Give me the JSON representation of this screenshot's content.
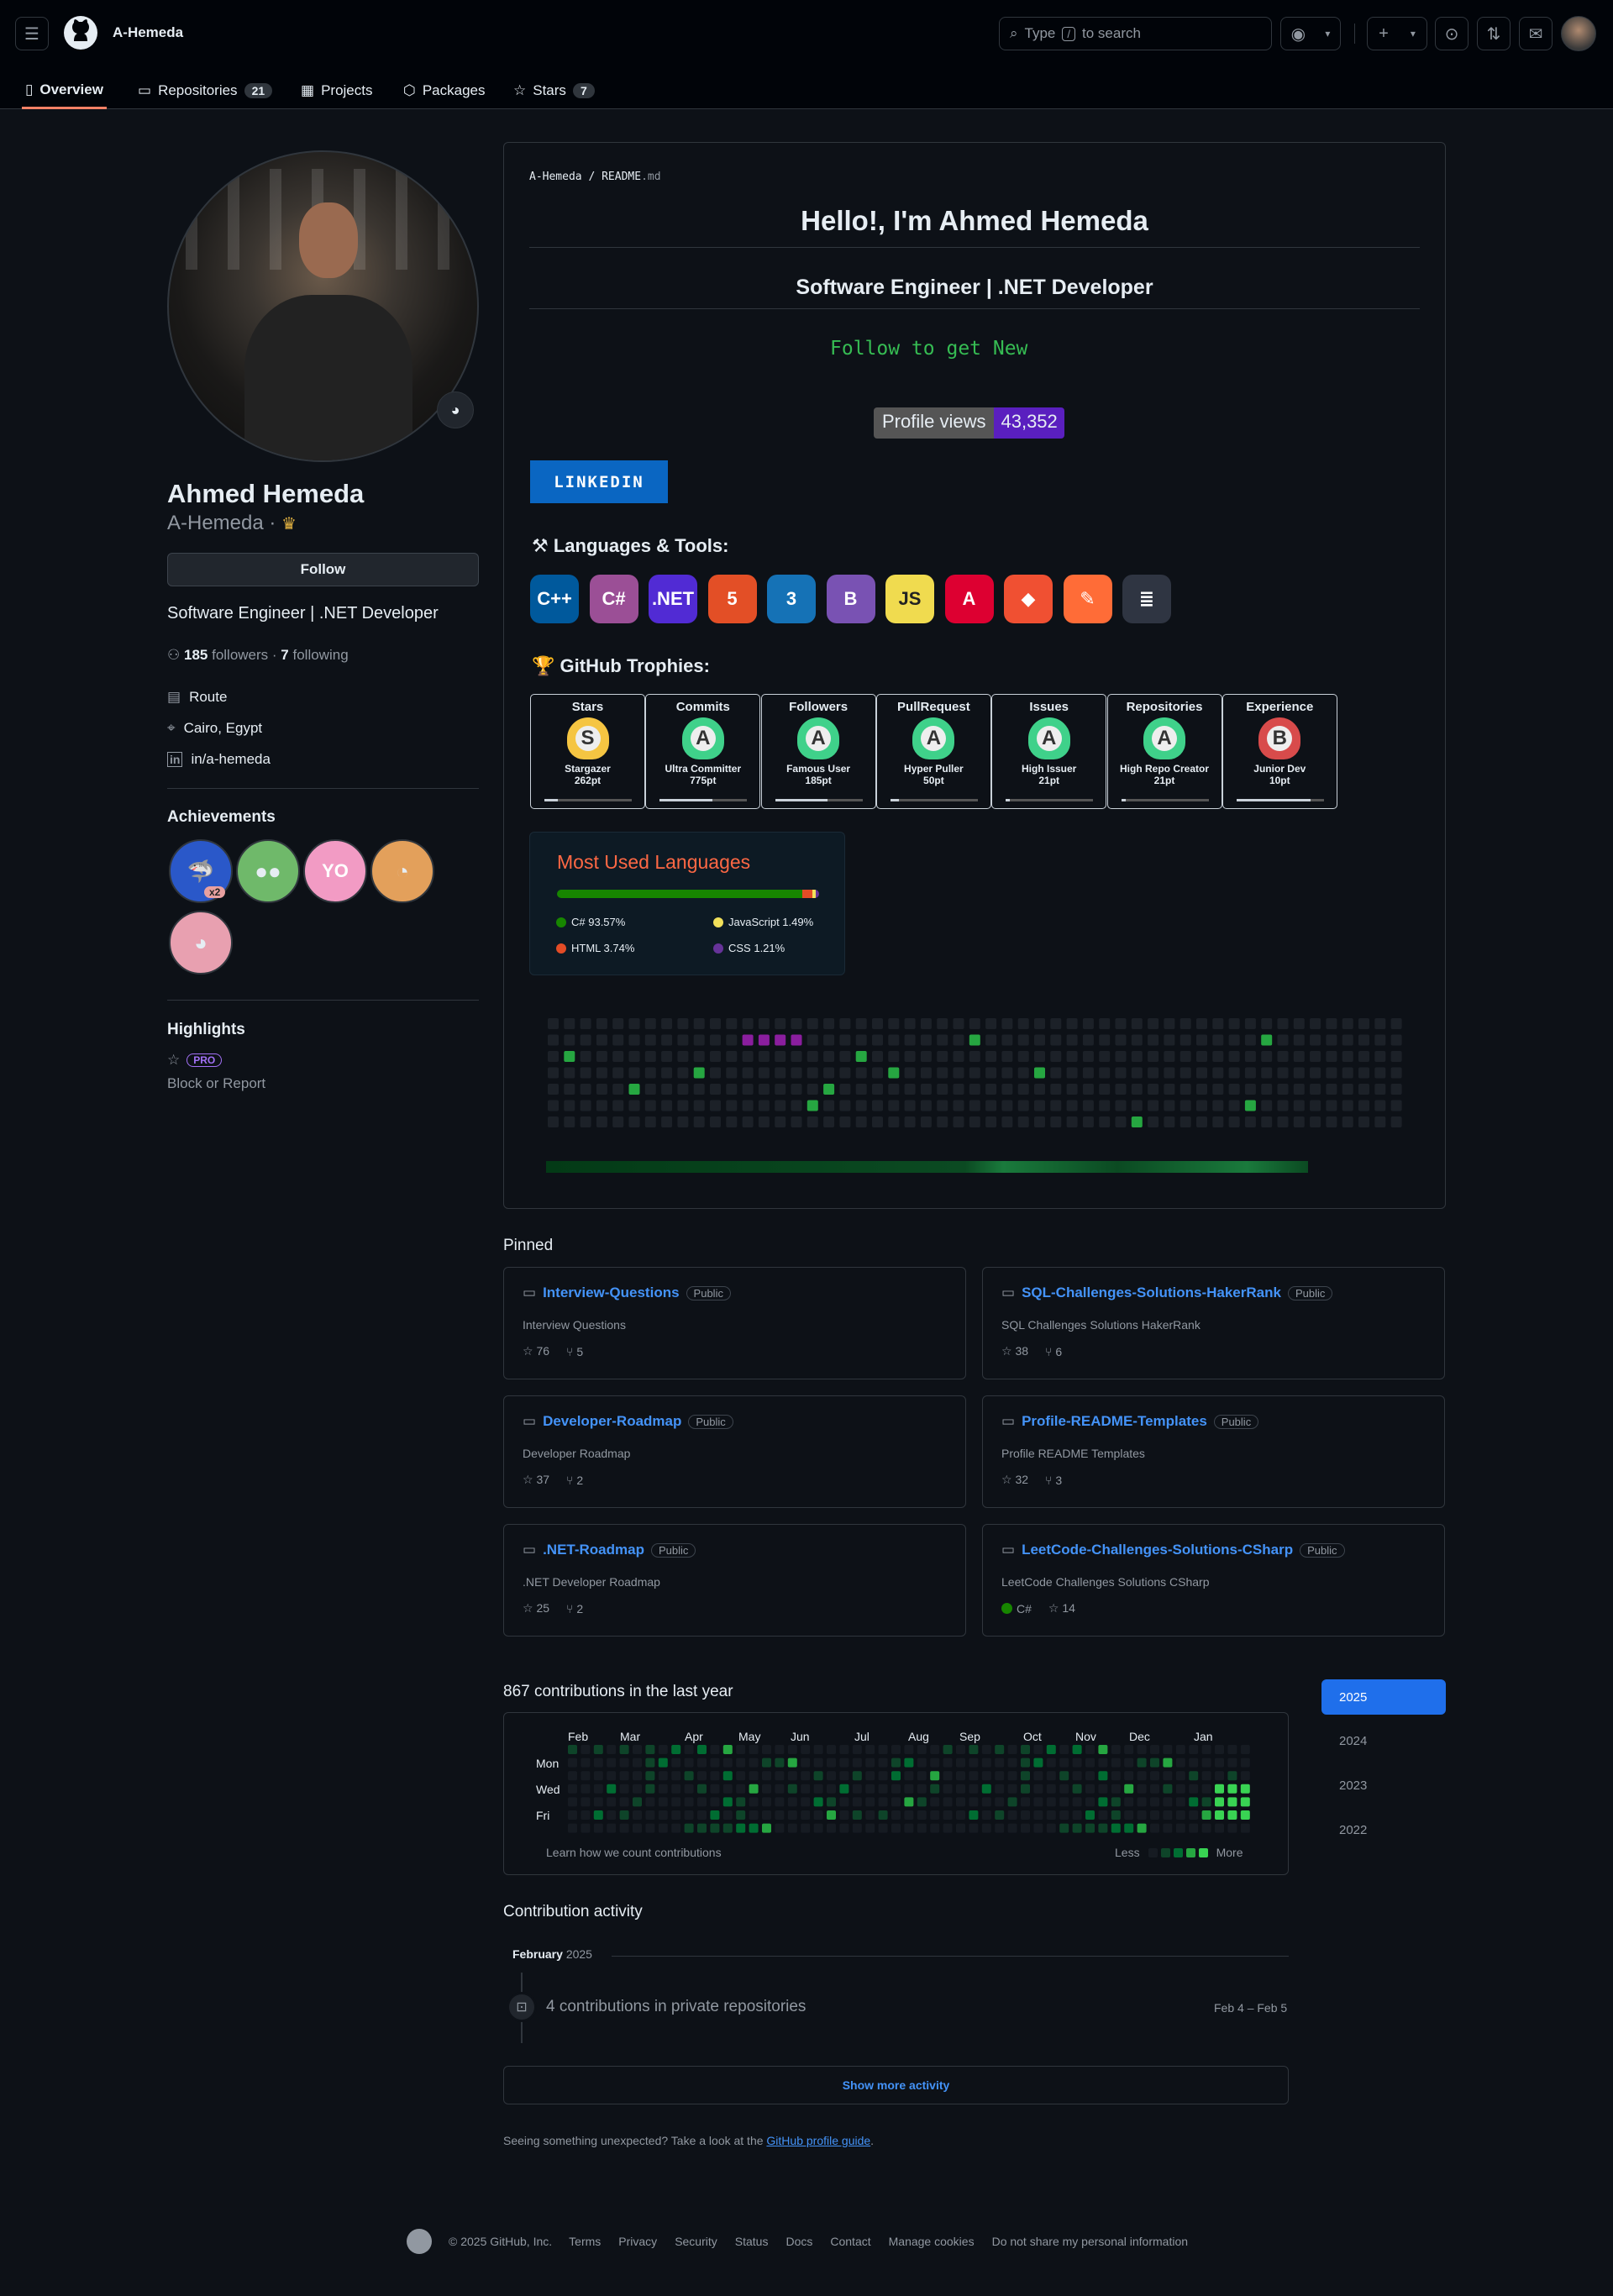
{
  "header": {
    "username": "A-Hemeda",
    "search_placeholder_pre": "Type",
    "search_key": "/",
    "search_placeholder_post": "to search",
    "tabs": [
      {
        "label": "Overview",
        "count": ""
      },
      {
        "label": "Repositories",
        "count": "21"
      },
      {
        "label": "Projects",
        "count": ""
      },
      {
        "label": "Packages",
        "count": ""
      },
      {
        "label": "Stars",
        "count": "7"
      }
    ]
  },
  "sidebar": {
    "name": "Ahmed Hemeda",
    "login": "A-Hemeda",
    "follow_label": "Follow",
    "bio": "Software Engineer | .NET Developer",
    "followers_count": "185",
    "followers_label": "followers",
    "following_count": "7",
    "following_label": "following",
    "company": "Route",
    "location": "Cairo, Egypt",
    "linkedin": "in/a-hemeda",
    "achievements_title": "Achievements",
    "achievement_multiplier": "x2",
    "highlights_title": "Highlights",
    "pro_label": "PRO",
    "block_label": "Block or Report"
  },
  "readme": {
    "breadcrumb_user": "A-Hemeda",
    "breadcrumb_file": "README",
    "breadcrumb_ext": ".md",
    "hello": "Hello!, I'm Ahmed Hemeda",
    "subtitle": "Software Engineer | .NET Developer",
    "typing_text": "Follow to get New",
    "profile_views_label": "Profile views",
    "profile_views_value": "43,352",
    "linkedin_badge": "LINKEDIN",
    "languages_title": "Languages & Tools:",
    "tools": [
      {
        "icon": "cplusplus-icon",
        "label": "C++",
        "color": "#00599c"
      },
      {
        "icon": "csharp-icon",
        "label": "C#",
        "color": "#9b4f96"
      },
      {
        "icon": "dotnet-icon",
        "label": ".NET",
        "color": "#512bd4"
      },
      {
        "icon": "html5-icon",
        "label": "5",
        "color": "#e34f26"
      },
      {
        "icon": "css3-icon",
        "label": "3",
        "color": "#1572b6"
      },
      {
        "icon": "bootstrap-icon",
        "label": "B",
        "color": "#7952b3"
      },
      {
        "icon": "javascript-icon",
        "label": "JS",
        "color": "#f0db4f"
      },
      {
        "icon": "angular-icon",
        "label": "A",
        "color": "#dd0031"
      },
      {
        "icon": "git-icon",
        "label": "◆",
        "color": "#f05032"
      },
      {
        "icon": "postman-icon",
        "label": "✎",
        "color": "#ff6c37"
      },
      {
        "icon": "stackoverflow-icon",
        "label": "≣",
        "color": "#2f3542"
      }
    ],
    "trophies_title": "GitHub Trophies:",
    "trophies": [
      {
        "title": "Stars",
        "rank": "S",
        "name": "Stargazer",
        "points": "262pt",
        "progress": 0.15
      },
      {
        "title": "Commits",
        "rank": "A",
        "name": "Ultra Committer",
        "points": "775pt",
        "progress": 0.6
      },
      {
        "title": "Followers",
        "rank": "A",
        "name": "Famous User",
        "points": "185pt",
        "progress": 0.6
      },
      {
        "title": "PullRequest",
        "rank": "A",
        "name": "Hyper Puller",
        "points": "50pt",
        "progress": 0.1
      },
      {
        "title": "Issues",
        "rank": "A",
        "name": "High Issuer",
        "points": "21pt",
        "progress": 0.05
      },
      {
        "title": "Repositories",
        "rank": "A",
        "name": "High Repo Creator",
        "points": "21pt",
        "progress": 0.05
      },
      {
        "title": "Experience",
        "rank": "B",
        "name": "Junior Dev",
        "points": "10pt",
        "progress": 0.85
      }
    ],
    "most_used_title": "Most Used Languages",
    "languages": [
      {
        "name": "C#",
        "percent": 93.57,
        "label": "C# 93.57%",
        "color": "#178600"
      },
      {
        "name": "HTML",
        "percent": 3.74,
        "label": "HTML 3.74%",
        "color": "#e34c26"
      },
      {
        "name": "JavaScript",
        "percent": 1.49,
        "label": "JavaScript 1.49%",
        "color": "#f1e05a"
      },
      {
        "name": "CSS",
        "percent": 1.21,
        "label": "CSS 1.21%",
        "color": "#663399"
      }
    ]
  },
  "pinned": {
    "title": "Pinned",
    "repos": [
      {
        "name": "Interview-Questions",
        "visibility": "Public",
        "desc": "Interview Questions",
        "lang": "",
        "stars": "76",
        "forks": "5"
      },
      {
        "name": "SQL-Challenges-Solutions-HakerRank",
        "visibility": "Public",
        "desc": "SQL Challenges Solutions HakerRank",
        "lang": "",
        "stars": "38",
        "forks": "6"
      },
      {
        "name": "Developer-Roadmap",
        "visibility": "Public",
        "desc": "Developer Roadmap",
        "lang": "",
        "stars": "37",
        "forks": "2"
      },
      {
        "name": "Profile-README-Templates",
        "visibility": "Public",
        "desc": "Profile README Templates",
        "lang": "",
        "stars": "32",
        "forks": "3"
      },
      {
        "name": ".NET-Roadmap",
        "visibility": "Public",
        "desc": ".NET Developer Roadmap",
        "lang": "",
        "stars": "25",
        "forks": "2"
      },
      {
        "name": "LeetCode-Challenges-Solutions-CSharp",
        "visibility": "Public",
        "desc": "LeetCode Challenges Solutions CSharp",
        "lang": "C#",
        "stars": "14",
        "forks": ""
      }
    ]
  },
  "contributions": {
    "title": "867 contributions in the last year",
    "months": [
      "Feb",
      "Mar",
      "Apr",
      "May",
      "Jun",
      "Jul",
      "Aug",
      "Sep",
      "Oct",
      "Nov",
      "Dec",
      "Jan"
    ],
    "days": [
      "Mon",
      "Wed",
      "Fri"
    ],
    "learn_link": "Learn how we count contributions",
    "less": "Less",
    "more": "More",
    "years": [
      "2025",
      "2024",
      "2023",
      "2022"
    ]
  },
  "activity": {
    "title": "Contribution activity",
    "month": "February",
    "year": "2025",
    "item": "4 contributions in private repositories",
    "range": "Feb 4 – Feb 5",
    "show_more": "Show more activity",
    "note_pre": "Seeing something unexpected? Take a look at the",
    "note_link": "GitHub profile guide",
    "note_post": "."
  },
  "footer": {
    "copyright": "© 2025 GitHub, Inc.",
    "links": [
      "Terms",
      "Privacy",
      "Security",
      "Status",
      "Docs",
      "Contact",
      "Manage cookies",
      "Do not share my personal information"
    ]
  },
  "colors": {
    "bg": "#0d1117",
    "accent_blue": "#4493f8",
    "contrib_levels": [
      "#161b22",
      "#0e4429",
      "#006d32",
      "#26a641",
      "#39d353"
    ]
  }
}
